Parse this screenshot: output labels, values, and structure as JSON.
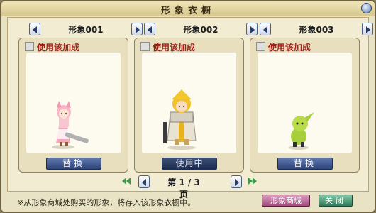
{
  "window": {
    "title": "形象衣橱"
  },
  "slots": [
    {
      "name": "形象001",
      "checkbox_label": "使用该加成",
      "button_label": "替换",
      "button_state": "normal"
    },
    {
      "name": "形象002",
      "checkbox_label": "使用该加成",
      "button_label": "使用中",
      "button_state": "active"
    },
    {
      "name": "形象003",
      "checkbox_label": "使用该加成",
      "button_label": "替换",
      "button_state": "normal"
    }
  ],
  "pager": {
    "label": "第 1 / 3 页"
  },
  "footer": {
    "note": "※从形象商城处购买的形象，将存入该形象衣橱中。",
    "shop_label": "形象商城",
    "close_label": "关闭"
  },
  "colors": {
    "accent_blue": "#2c4378",
    "shop_pink": "#a24b7c",
    "close_green": "#2f7c58",
    "label_red": "#a1221a"
  }
}
